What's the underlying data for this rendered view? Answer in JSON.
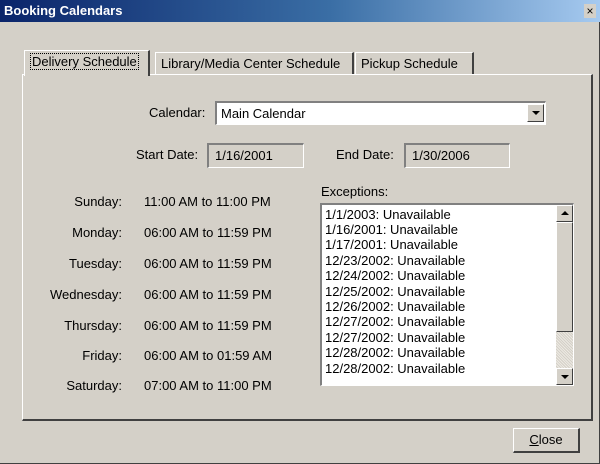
{
  "window": {
    "title": "Booking Calendars",
    "close_glyph": "×"
  },
  "tabs": [
    {
      "label": "Delivery Schedule",
      "active": true
    },
    {
      "label": "Library/Media Center Schedule",
      "active": false
    },
    {
      "label": "Pickup Schedule",
      "active": false
    }
  ],
  "calendar": {
    "label": "Calendar:",
    "value": "Main Calendar"
  },
  "start_date": {
    "label": "Start Date:",
    "value": "1/16/2001"
  },
  "end_date": {
    "label": "End Date:",
    "value": "1/30/2006"
  },
  "schedule": [
    {
      "day": "Sunday:",
      "hours": "11:00 AM to 11:00 PM"
    },
    {
      "day": "Monday:",
      "hours": "06:00 AM to 11:59 PM"
    },
    {
      "day": "Tuesday:",
      "hours": "06:00 AM to 11:59 PM"
    },
    {
      "day": "Wednesday:",
      "hours": "06:00 AM to 11:59 PM"
    },
    {
      "day": "Thursday:",
      "hours": "06:00 AM to 11:59 PM"
    },
    {
      "day": "Friday:",
      "hours": "06:00 AM to 01:59 AM"
    },
    {
      "day": "Saturday:",
      "hours": "07:00 AM to 11:00 PM"
    }
  ],
  "exceptions": {
    "label": "Exceptions:",
    "items": [
      "1/1/2003:  Unavailable",
      "1/16/2001:  Unavailable",
      "1/17/2001:  Unavailable",
      "12/23/2002:  Unavailable",
      "12/24/2002:  Unavailable",
      "12/25/2002:  Unavailable",
      "12/26/2002:  Unavailable",
      "12/27/2002:  Unavailable",
      "12/27/2002:  Unavailable",
      "12/28/2002:  Unavailable",
      "12/28/2002:  Unavailable"
    ]
  },
  "buttons": {
    "close_first": "C",
    "close_rest": "lose"
  },
  "colors": {
    "titlebar_start": "#0a246a",
    "titlebar_end": "#a6caf0",
    "face": "#d4d0c8"
  }
}
